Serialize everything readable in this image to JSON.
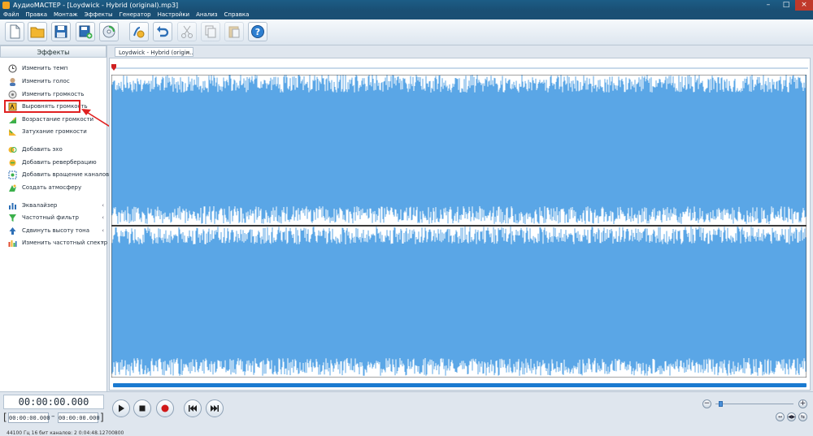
{
  "window": {
    "title": "АудиоМАСТЕР - [Loydwick - Hybrid (original).mp3]"
  },
  "menu": [
    "Файл",
    "Правка",
    "Монтаж",
    "Эффекты",
    "Генератор",
    "Настройки",
    "Анализ",
    "Справка"
  ],
  "toolbar": {
    "buttons": [
      {
        "name": "new-file-button",
        "icon": "new-file-icon"
      },
      {
        "name": "open-button",
        "icon": "folder-icon"
      },
      {
        "name": "save-button",
        "icon": "floppy-icon"
      },
      {
        "name": "save-as-button",
        "icon": "save-plus-icon"
      },
      {
        "name": "record-cd-button",
        "icon": "cd-icon"
      },
      {
        "name": "edit-button",
        "icon": "audio-edit-icon"
      },
      {
        "name": "undo-button",
        "icon": "undo-icon"
      },
      {
        "name": "cut-button",
        "icon": "scissors-icon"
      },
      {
        "name": "copy-button",
        "icon": "copy-icon"
      },
      {
        "name": "paste-button",
        "icon": "paste-icon"
      },
      {
        "name": "help-button",
        "icon": "help-icon"
      }
    ]
  },
  "sidebar": {
    "header": "Эффекты",
    "items": [
      {
        "label": "Изменить темп",
        "icon": "clock-icon",
        "has_submenu": false
      },
      {
        "label": "Изменить голос",
        "icon": "voice-icon",
        "has_submenu": false
      },
      {
        "label": "Изменить громкость",
        "icon": "volume-icon",
        "has_submenu": false
      },
      {
        "label": "Выровнять громкость",
        "icon": "normalize-icon",
        "has_submenu": false,
        "highlighted": true
      },
      {
        "label": "Возрастание громкости",
        "icon": "fade-in-icon",
        "has_submenu": false
      },
      {
        "label": "Затухание громкости",
        "icon": "fade-out-icon",
        "has_submenu": false
      },
      {
        "label": "Добавить эхо",
        "icon": "echo-icon",
        "has_submenu": false
      },
      {
        "label": "Добавить реверберацию",
        "icon": "reverb-icon",
        "has_submenu": false
      },
      {
        "label": "Добавить вращение каналов",
        "icon": "rotate-icon",
        "has_submenu": false
      },
      {
        "label": "Создать атмосферу",
        "icon": "atmosphere-icon",
        "has_submenu": false
      },
      {
        "label": "Эквалайзер",
        "icon": "equalizer-icon",
        "has_submenu": true
      },
      {
        "label": "Частотный фильтр",
        "icon": "filter-icon",
        "has_submenu": true
      },
      {
        "label": "Сдвинуть высоту тона",
        "icon": "pitch-icon",
        "has_submenu": true
      },
      {
        "label": "Изменить частотный спектр",
        "icon": "spectrum-icon",
        "has_submenu": true
      }
    ]
  },
  "editor": {
    "tab_label": "Loydwick - Hybrid (origin...",
    "tab_close": "×",
    "wave_color": "#5aa6e6"
  },
  "transport": {
    "current_time": "00:00:00.000",
    "selection_start": "00:00:00.000",
    "selection_end": "00:00:00.000",
    "dash": "–",
    "bracket_left": "[",
    "bracket_right": "]",
    "buttons": [
      "play-icon",
      "stop-icon",
      "record-icon",
      "skip-back-icon",
      "skip-forward-icon"
    ]
  },
  "zoom": {
    "minus": "−",
    "plus": "+",
    "level": 0.05
  },
  "view_buttons": [
    "↔",
    "◀▶",
    "⇆"
  ],
  "status": {
    "text": "44100 Гц  16 бит  каналов: 2   0:04:48.12700800"
  },
  "colors": {
    "accent": "#1a7ad0",
    "highlight": "#e02020",
    "titlebar": "#1a4f74"
  }
}
